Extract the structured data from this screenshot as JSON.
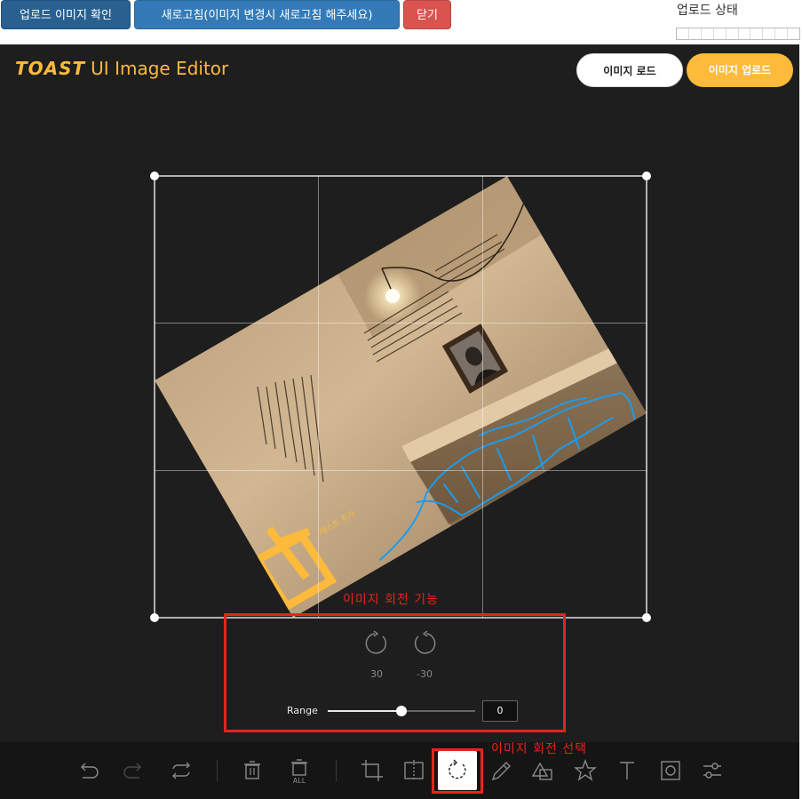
{
  "toolbar": {
    "check_upload_label": "업로드 이미지 확인",
    "refresh_label": "새로고침(이미지 변경시 새로고침 해주세요)",
    "close_label": "닫기",
    "upload_status_label": "업로드 상태",
    "upload_progress": 0
  },
  "editor": {
    "logo_toast": "TOAST",
    "logo_rest": "UI Image Editor",
    "load_button": "이미지 로드",
    "upload_button": "이미지 업로드"
  },
  "photo": {
    "handwritten_tag": "테스트 추가"
  },
  "rotate_menu": {
    "annotation_title": "이미지 회전 기능",
    "cw_label": "30",
    "ccw_label": "-30",
    "range_label": "Range",
    "range_value": "0",
    "range_fraction": 0.5,
    "selection_annotation": "이미지 회전 선택"
  },
  "bottom_menu": {
    "items": [
      {
        "name": "undo-icon",
        "interactable": true
      },
      {
        "name": "redo-icon",
        "interactable": true
      },
      {
        "name": "reset-icon",
        "interactable": true
      },
      {
        "name": "delete-icon",
        "interactable": true
      },
      {
        "name": "delete-all-icon",
        "interactable": true
      },
      {
        "name": "crop-icon",
        "interactable": true
      },
      {
        "name": "flip-icon",
        "interactable": true
      },
      {
        "name": "rotate-icon",
        "interactable": true,
        "selected": true
      },
      {
        "name": "draw-icon",
        "interactable": true
      },
      {
        "name": "shape-icon",
        "interactable": true
      },
      {
        "name": "icon-icon",
        "interactable": true
      },
      {
        "name": "text-icon",
        "interactable": true
      },
      {
        "name": "mask-icon",
        "interactable": true
      },
      {
        "name": "filter-icon",
        "interactable": true
      }
    ],
    "delete_all_caption": "ALL"
  },
  "colors": {
    "accent": "#fdba3b",
    "annotation": "#e8231c",
    "editor_bg": "#1e1e1e",
    "menu_bg": "#151515",
    "drawing_stroke": "#1e9bea"
  }
}
